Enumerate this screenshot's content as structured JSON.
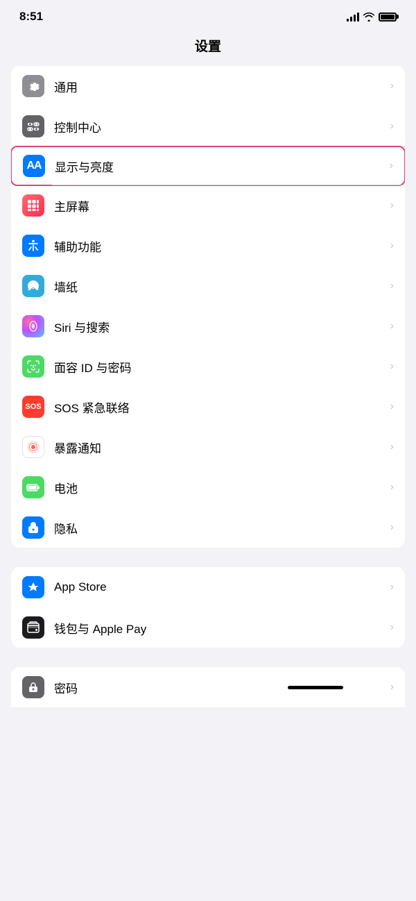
{
  "statusBar": {
    "time": "8:51",
    "signalLabel": "signal",
    "wifiLabel": "wifi",
    "batteryLabel": "battery"
  },
  "pageTitle": "设置",
  "sections": [
    {
      "id": "general-section",
      "items": [
        {
          "id": "general",
          "label": "通用",
          "iconColor": "gray",
          "iconType": "gear",
          "highlighted": false
        },
        {
          "id": "control-center",
          "label": "控制中心",
          "iconColor": "gray2",
          "iconType": "toggle",
          "highlighted": false
        },
        {
          "id": "display",
          "label": "显示与亮度",
          "iconColor": "blue",
          "iconType": "aa",
          "highlighted": true
        },
        {
          "id": "homescreen",
          "label": "主屏幕",
          "iconColor": "grid",
          "iconType": "grid",
          "highlighted": false
        },
        {
          "id": "accessibility",
          "label": "辅助功能",
          "iconColor": "blue",
          "iconType": "accessibility",
          "highlighted": false
        },
        {
          "id": "wallpaper",
          "label": "墙纸",
          "iconColor": "wallpaper",
          "iconType": "flower",
          "highlighted": false
        },
        {
          "id": "siri",
          "label": "Siri 与搜索",
          "iconColor": "siri",
          "iconType": "siri",
          "highlighted": false
        },
        {
          "id": "faceid",
          "label": "面容 ID 与密码",
          "iconColor": "faceid",
          "iconType": "faceid",
          "highlighted": false
        },
        {
          "id": "sos",
          "label": "SOS 紧急联络",
          "iconColor": "sos",
          "iconType": "sos",
          "highlighted": false
        },
        {
          "id": "exposure",
          "label": "暴露通知",
          "iconColor": "exposure",
          "iconType": "exposure",
          "highlighted": false
        },
        {
          "id": "battery",
          "label": "电池",
          "iconColor": "battery",
          "iconType": "battery",
          "highlighted": false
        },
        {
          "id": "privacy",
          "label": "隐私",
          "iconColor": "privacy",
          "iconType": "hand",
          "highlighted": false
        }
      ]
    },
    {
      "id": "apps-section",
      "items": [
        {
          "id": "appstore",
          "label": "App Store",
          "iconColor": "appstore",
          "iconType": "appstore",
          "highlighted": false
        },
        {
          "id": "wallet",
          "label": "钱包与 Apple Pay",
          "iconColor": "wallet",
          "iconType": "wallet",
          "highlighted": false
        }
      ]
    }
  ],
  "partialSection": {
    "item": {
      "id": "password",
      "label": "密码",
      "iconColor": "password",
      "iconType": "password"
    }
  }
}
